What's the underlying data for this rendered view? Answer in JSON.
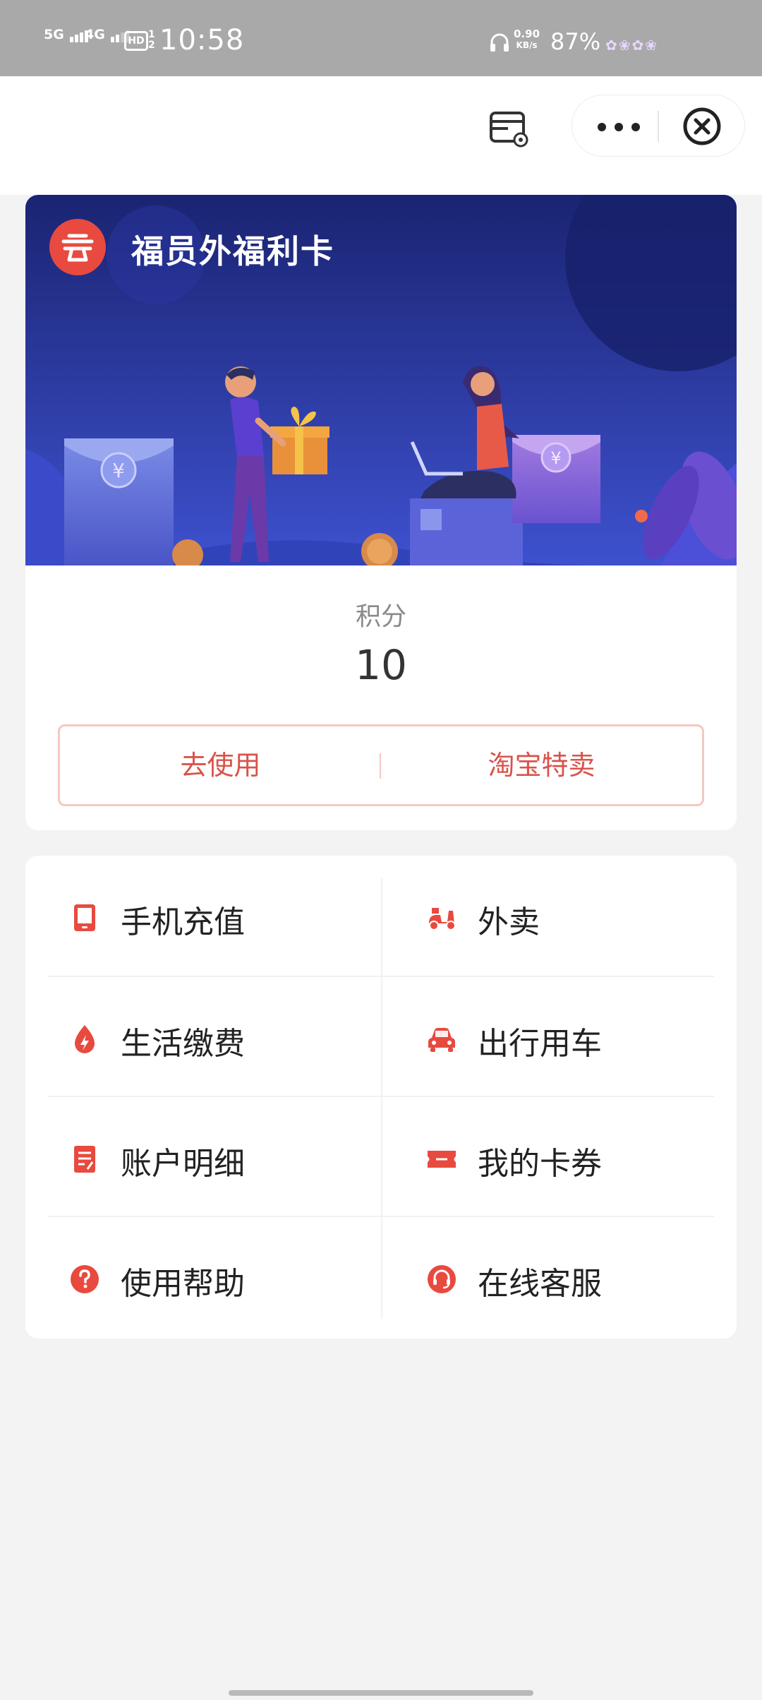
{
  "status_bar": {
    "network_1": "5G",
    "network_2": "4G",
    "hd_label": "HD",
    "hd_sub": "1 2",
    "time": "10:58",
    "speed_value": "0.90",
    "speed_unit": "KB/s",
    "battery": "87%"
  },
  "card": {
    "brand_name": "福员外福利卡",
    "points_label": "积分",
    "points_value": "10",
    "use_button": "去使用",
    "taobao_button": "淘宝特卖"
  },
  "services": [
    {
      "label": "手机充值",
      "icon": "phone-recharge-icon"
    },
    {
      "label": "外卖",
      "icon": "scooter-icon"
    },
    {
      "label": "生活缴费",
      "icon": "utility-drop-icon"
    },
    {
      "label": "出行用车",
      "icon": "car-icon"
    },
    {
      "label": "账户明细",
      "icon": "document-icon"
    },
    {
      "label": "我的卡券",
      "icon": "ticket-icon"
    },
    {
      "label": "使用帮助",
      "icon": "help-icon"
    },
    {
      "label": "在线客服",
      "icon": "headset-icon"
    }
  ],
  "colors": {
    "accent_red": "#e84a3f",
    "banner_dark": "#1a2472",
    "banner_light": "#3e51cf"
  }
}
